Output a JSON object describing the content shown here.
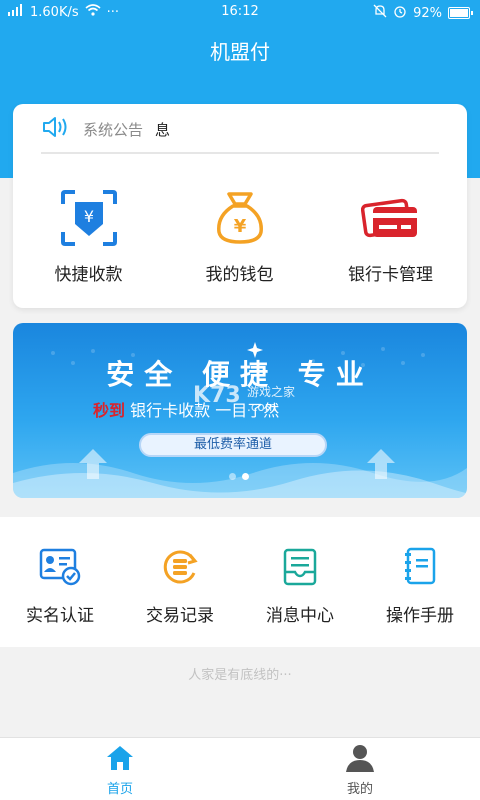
{
  "status_bar": {
    "network": "1.60K/s",
    "time": "16:12",
    "battery": "92%",
    "more": "···"
  },
  "app": {
    "title": "机盟付"
  },
  "notice": {
    "label": "系统公告",
    "text": "息"
  },
  "quick_actions": [
    {
      "label": "快捷收款",
      "icon": "qr-receive-icon"
    },
    {
      "label": "我的钱包",
      "icon": "money-bag-icon"
    },
    {
      "label": "银行卡管理",
      "icon": "bank-card-icon"
    }
  ],
  "banner": {
    "title": "安全 便捷 专业",
    "sub_red": "秒到",
    "sub_text": "银行卡收款",
    "sub_tail": "一目了然",
    "pill": "最低费率通道",
    "watermark_logo": "K73",
    "watermark_text": "游戏之家",
    "watermark_domain": ".com",
    "page": 2,
    "pages": 2
  },
  "grid": [
    {
      "label": "实名认证",
      "icon": "id-card-check-icon"
    },
    {
      "label": "交易记录",
      "icon": "coins-history-icon"
    },
    {
      "label": "消息中心",
      "icon": "message-doc-icon"
    },
    {
      "label": "操作手册",
      "icon": "manual-book-icon"
    }
  ],
  "footer": {
    "hint": "人家是有底线的···"
  },
  "tabs": [
    {
      "label": "首页",
      "active": true,
      "icon": "home-icon"
    },
    {
      "label": "我的",
      "active": false,
      "icon": "user-icon"
    }
  ],
  "colors": {
    "primary": "#21a9ef",
    "accent_orange": "#f4a224",
    "accent_red": "#d9242c",
    "tab_active": "#1aa3ea",
    "tab_inactive": "#555555"
  }
}
